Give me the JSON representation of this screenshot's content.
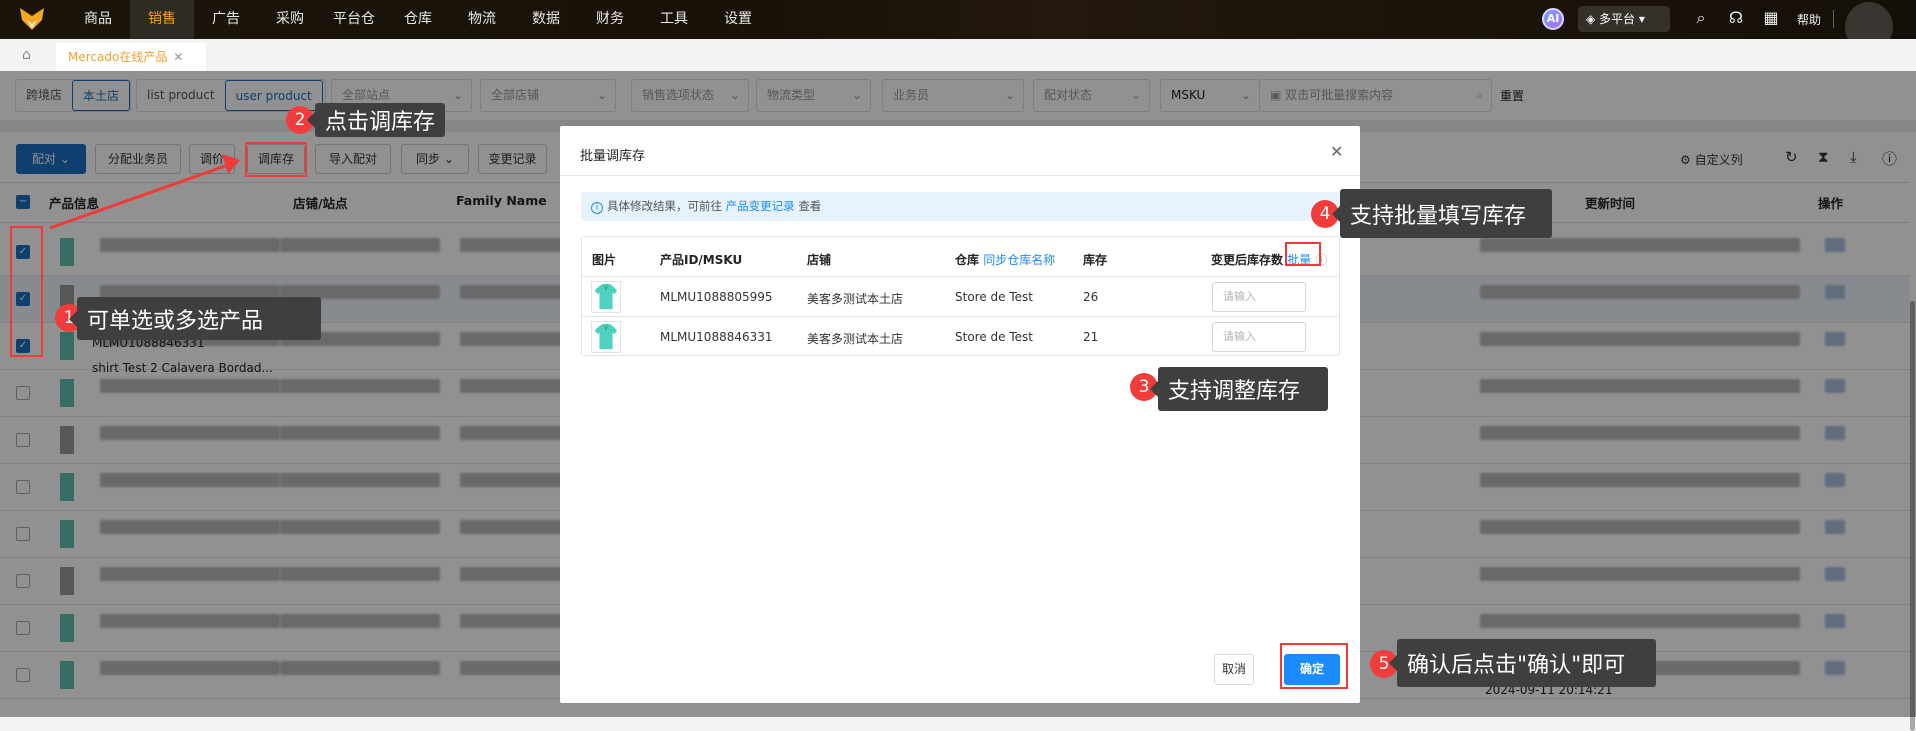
{
  "nav": {
    "menu": [
      "商品",
      "销售",
      "广告",
      "采购",
      "平台仓",
      "仓库",
      "物流",
      "数据",
      "财务",
      "工具",
      "设置"
    ],
    "active_index": 1,
    "ai": "AI",
    "platform": "多平台 ▾",
    "help": "帮助"
  },
  "tabs": {
    "current": "Mercado在线产品",
    "close": "✕"
  },
  "filters": {
    "store_type": [
      "跨境店",
      "本土店"
    ],
    "product_type": [
      "list product",
      "user product"
    ],
    "site": "全部站点",
    "shop": "全部店铺",
    "sale_option": "销售选项状态",
    "logistics": "物流类型",
    "salesperson": "业务员",
    "pair_status": "配对状态",
    "search_field": "MSKU",
    "search_placeholder": "双击可批量搜索内容",
    "reset": "重置"
  },
  "toolbar": {
    "pair": "配对",
    "assign": "分配业务员",
    "price": "调价",
    "stock": "调库存",
    "import_pair": "导入配对",
    "sync": "同步",
    "change_log": "变更记录",
    "custom_cols": "自定义列"
  },
  "table": {
    "headers": {
      "product": "产品信息",
      "shop": "店铺/站点",
      "family": "Family Name",
      "updated": "更新时间",
      "action": "操作"
    },
    "visible_fragments": {
      "msku": "MLMU1088846331",
      "title": "shirt Test 2 Calavera Bordad...",
      "time": "2024-09-11 20:14:21"
    }
  },
  "modal": {
    "title": "批量调库存",
    "info_prefix": "具体修改结果，可前往",
    "info_link": "产品变更记录",
    "info_suffix": "查看",
    "headers": {
      "image": "图片",
      "id": "产品ID/MSKU",
      "shop": "店铺",
      "warehouse": "仓库",
      "sync_wh": "同步仓库名称",
      "stock": "库存",
      "new_stock": "变更后库存数",
      "batch": "批量"
    },
    "rows": [
      {
        "id": "MLMU1088805995",
        "shop": "美客多测试本土店",
        "warehouse": "Store de Test",
        "stock": "26",
        "new_stock": ""
      },
      {
        "id": "MLMU1088846331",
        "shop": "美客多测试本土店",
        "warehouse": "Store de Test",
        "stock": "21",
        "new_stock": ""
      }
    ],
    "placeholder": "请输入",
    "cancel": "取消",
    "ok": "确定"
  },
  "annotations": [
    {
      "n": "1",
      "text": "可单选或多选产品"
    },
    {
      "n": "2",
      "text": "点击调库存"
    },
    {
      "n": "3",
      "text": "支持调整库存"
    },
    {
      "n": "4",
      "text": "支持批量填写库存"
    },
    {
      "n": "5",
      "text": "确认后点击\"确认\"即可"
    }
  ],
  "colors": {
    "accent": "#1a8cff",
    "nav_active": "#ff9d1c",
    "annotation": "#f23c3c"
  }
}
